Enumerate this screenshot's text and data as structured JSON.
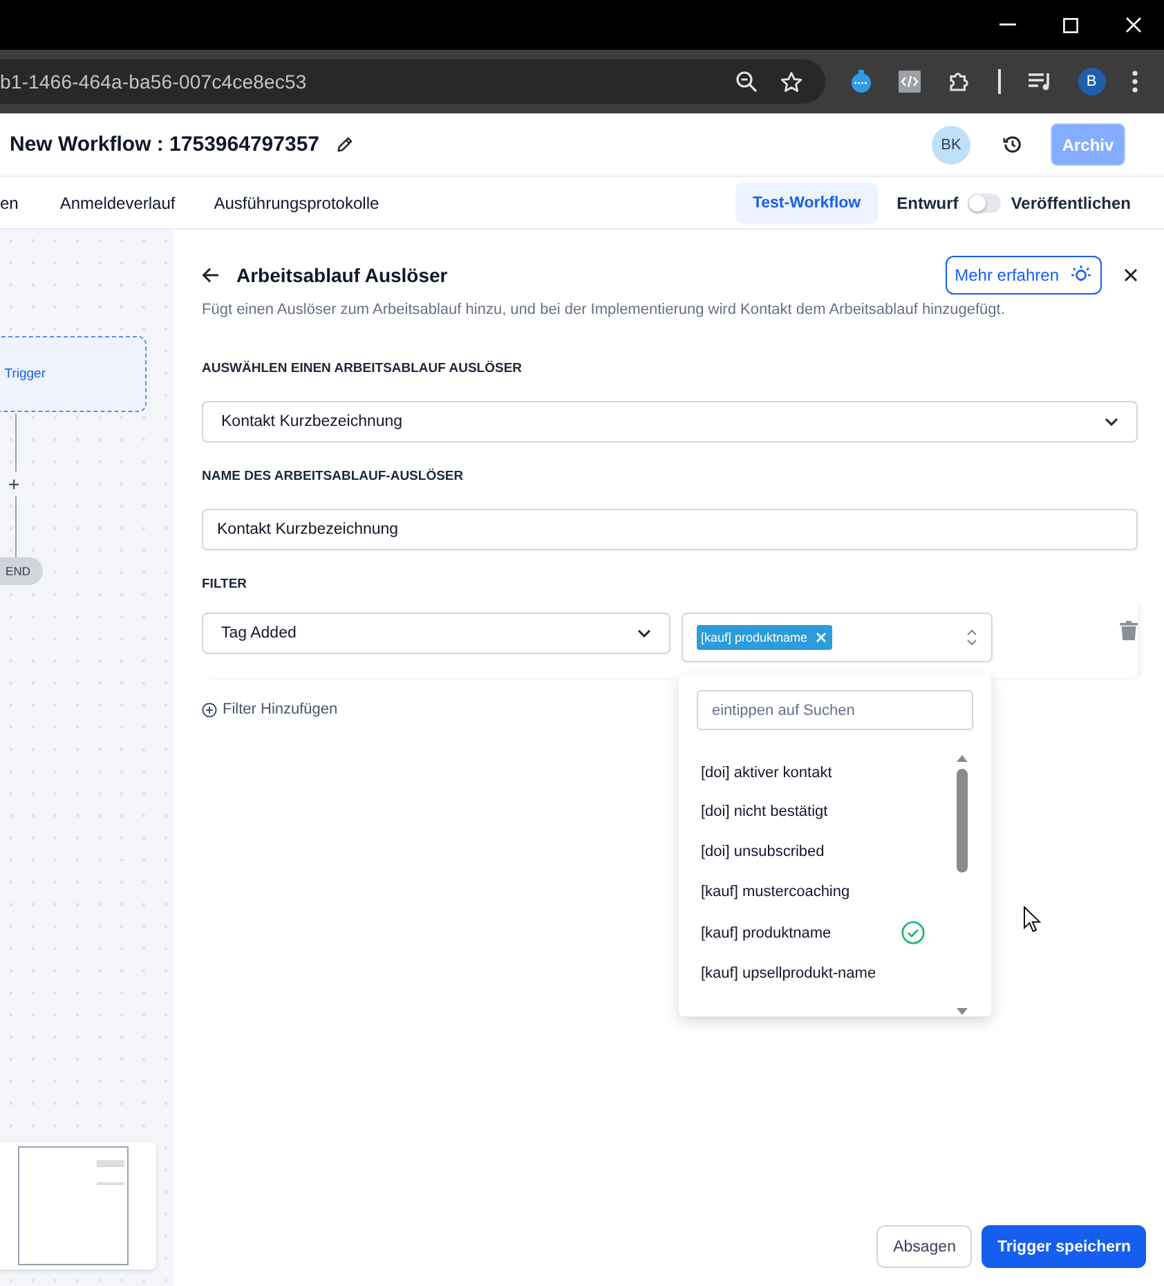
{
  "browser": {
    "url": "b1-1466-464a-ba56-007c4ce8ec53",
    "profile_initial": "B"
  },
  "header": {
    "title": "New Workflow : 1753964797357",
    "avatar": "BK",
    "archive_button": {
      "label": "Archiv",
      "disabled": true
    }
  },
  "tabs": [
    {
      "label": "en"
    },
    {
      "label": "Anmeldeverlauf"
    },
    {
      "label": "Ausführungsprotokolle"
    }
  ],
  "actions": {
    "test_button": "Test-Workflow",
    "draft_label": "Entwurf",
    "publish_toggle": {
      "on": false
    },
    "publish_label": "Veröffentlichen"
  },
  "canvas": {
    "trigger_node": "Trigger",
    "add_symbol": "+",
    "end_node": "END"
  },
  "panel": {
    "title": "Arbeitsablauf Auslöser",
    "learn_more": "Mehr erfahren",
    "description": "Fügt einen Auslöser zum Arbeitsablauf hinzu, und bei der Implementierung wird Kontakt dem Arbeitsablauf hinzugefügt.",
    "trigger_label": "AUSWÄHLEN EINEN ARBEITSABLAUF AUSLÖSER",
    "trigger_select": "Kontakt Kurzbezeichnung",
    "name_label": "NAME DES ARBEITSABLAUF-AUSLÖSER",
    "name_value": "Kontakt Kurzbezeichnung",
    "filter_label": "FILTER",
    "filters": [
      {
        "field": "Tag Added",
        "tags": [
          "[kauf] produktname"
        ]
      }
    ],
    "add_filter": "Filter Hinzufügen",
    "dropdown": {
      "placeholder": "eintippen auf Suchen",
      "options": [
        {
          "label": "[doi] aktiver kontakt",
          "selected": false
        },
        {
          "label": "[doi] nicht bestätigt",
          "selected": false
        },
        {
          "label": "[doi] unsubscribed",
          "selected": false
        },
        {
          "label": "[kauf] mustercoaching",
          "selected": false
        },
        {
          "label": "[kauf] produktname",
          "selected": true
        },
        {
          "label": "[kauf] upsellprodukt-name",
          "selected": false
        }
      ]
    },
    "cancel_button": "Absagen",
    "save_button": "Trigger speichern"
  }
}
